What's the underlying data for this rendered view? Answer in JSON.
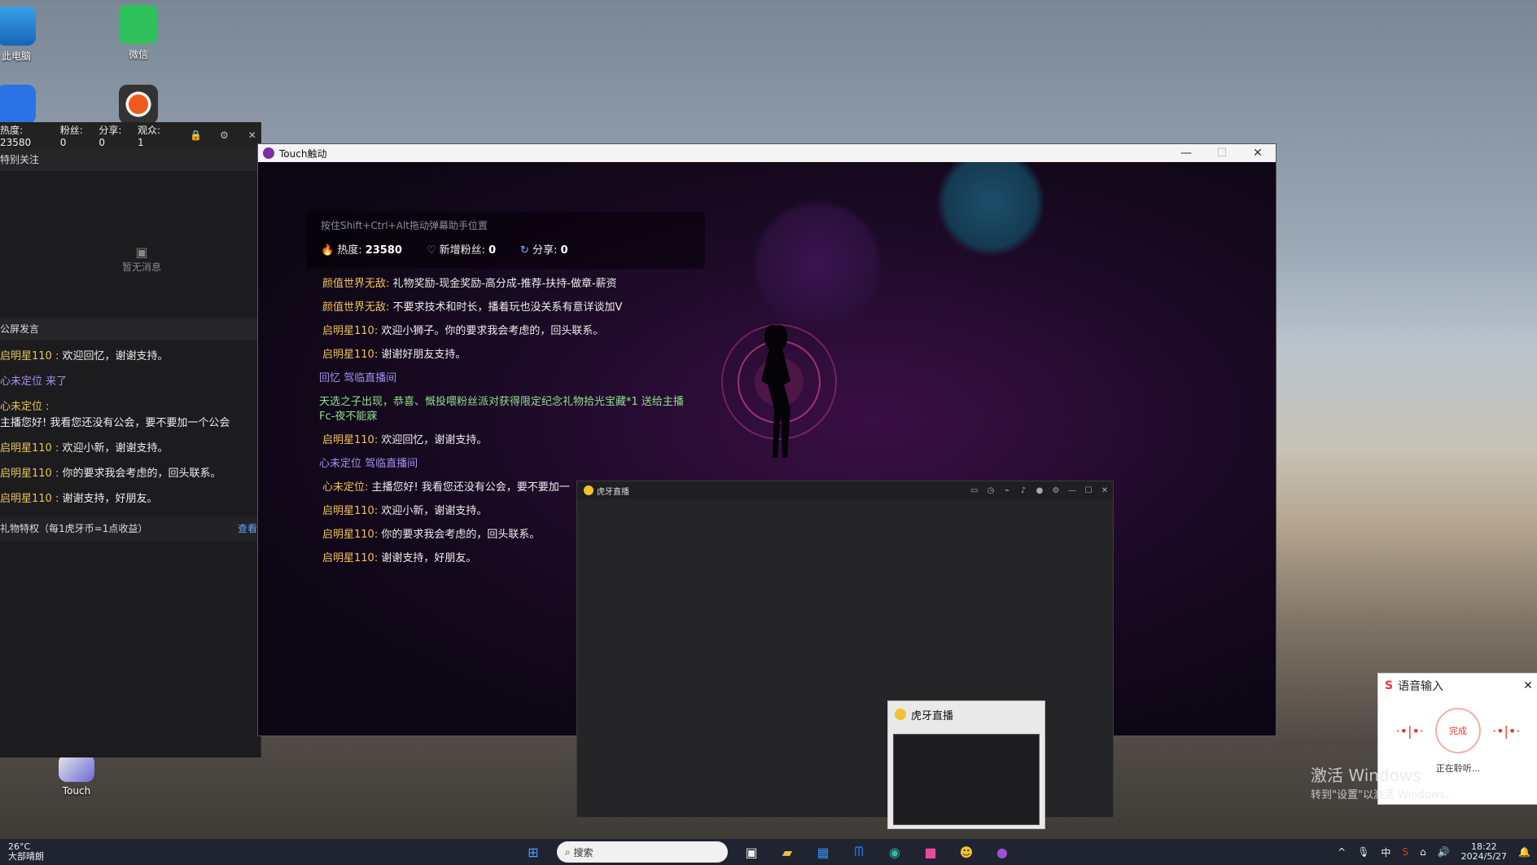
{
  "desktop": {
    "icons": [
      {
        "label": "此电脑",
        "icon": "computer-icon"
      },
      {
        "label": "微信",
        "icon": "wechat-icon"
      },
      {
        "label": "",
        "icon": "app-m-icon"
      },
      {
        "label": "",
        "icon": "record-icon"
      },
      {
        "label": "Touch",
        "icon": "touch-app-icon"
      }
    ]
  },
  "left_panel": {
    "hot_label": "热度: 23580",
    "fans_label": "粉丝: 0",
    "share_label": "分享: 0",
    "viewers_label": "观众: 1",
    "special_title": "特别关注",
    "empty_text": "暂无消息",
    "public_title": "公屏发言",
    "chat": [
      {
        "nick": "启明星110 :",
        "text": " 欢迎回忆，谢谢支持。",
        "type": "msg"
      },
      {
        "nick": "",
        "text": "心未定位 来了",
        "type": "join"
      },
      {
        "nick": "心未定位 :",
        "text": "",
        "type": "msg"
      },
      {
        "nick": "",
        "text": " 主播您好! 我看您还没有公会，要不要加一个公会",
        "type": "plain"
      },
      {
        "nick": "启明星110 :",
        "text": " 欢迎小新，谢谢支持。",
        "type": "msg"
      },
      {
        "nick": "启明星110 :",
        "text": " 你的要求我会考虑的，回头联系。",
        "type": "msg"
      },
      {
        "nick": "启明星110 :",
        "text": " 谢谢支持，好朋友。",
        "type": "msg"
      }
    ],
    "gift_title": "礼物特权（每1虎牙币=1点收益）",
    "gift_more": "查看"
  },
  "touch_window": {
    "title": "Touch触动",
    "hint": "按住Shift+Ctrl+Alt拖动弹幕助手位置",
    "hot_label": "热度: ",
    "hot_value": "23580",
    "fans_label": "新增粉丝: ",
    "fans_value": "0",
    "share_label": "分享: ",
    "share_value": "0",
    "feed": [
      {
        "nick": "颜值世界无敌:",
        "text": " 礼物奖励-现金奖励-高分成-推荐-扶持-做章-薪资",
        "kind": "msg"
      },
      {
        "nick": "颜值世界无敌:",
        "text": " 不要求技术和时长，播着玩也没关系有意详谈加V",
        "kind": "msg"
      },
      {
        "nick": "启明星110:",
        "text": " 欢迎小狮子。你的要求我会考虑的，回头联系。",
        "kind": "msg"
      },
      {
        "nick": "启明星110:",
        "text": " 谢谢好朋友支持。",
        "kind": "msg"
      },
      {
        "nick": "",
        "text": "回忆 驾临直播间",
        "kind": "join"
      },
      {
        "nick": "",
        "text": "天选之子出现，恭喜、慨投喂粉丝派对获得限定纪念礼物拾光宝藏*1 送给主播Fc-夜不能寐",
        "kind": "green"
      },
      {
        "nick": "启明星110:",
        "text": " 欢迎回忆，谢谢支持。",
        "kind": "msg"
      },
      {
        "nick": "",
        "text": "心未定位 驾临直播间",
        "kind": "join"
      },
      {
        "nick": "心未定位:",
        "text": " 主播您好! 我看您还没有公会，要不要加一",
        "kind": "msg"
      },
      {
        "nick": "启明星110:",
        "text": " 欢迎小新，谢谢支持。",
        "kind": "msg"
      },
      {
        "nick": "启明星110:",
        "text": " 你的要求我会考虑的，回头联系。",
        "kind": "msg"
      },
      {
        "nick": "启明星110:",
        "text": " 谢谢支持，好朋友。",
        "kind": "msg"
      }
    ]
  },
  "huya_window": {
    "title": "虎牙直播"
  },
  "thumbnail": {
    "title": "虎牙直播"
  },
  "voice_input": {
    "title": "语音输入",
    "done": "完成",
    "status": "正在聆听..."
  },
  "activation": {
    "line1": "激活 Windows",
    "line2": "转到\"设置\"以激活 Windows。"
  },
  "taskbar": {
    "weather_temp": "26°C",
    "weather_desc": "大部晴朗",
    "search_placeholder": "搜索",
    "ime": "中",
    "time": "18:22",
    "date": "2024/5/27"
  },
  "colors": {
    "nick": "#e8c45a",
    "join": "#a98df0",
    "gift": "#8fe08f",
    "accent": "#7a2ea8"
  }
}
